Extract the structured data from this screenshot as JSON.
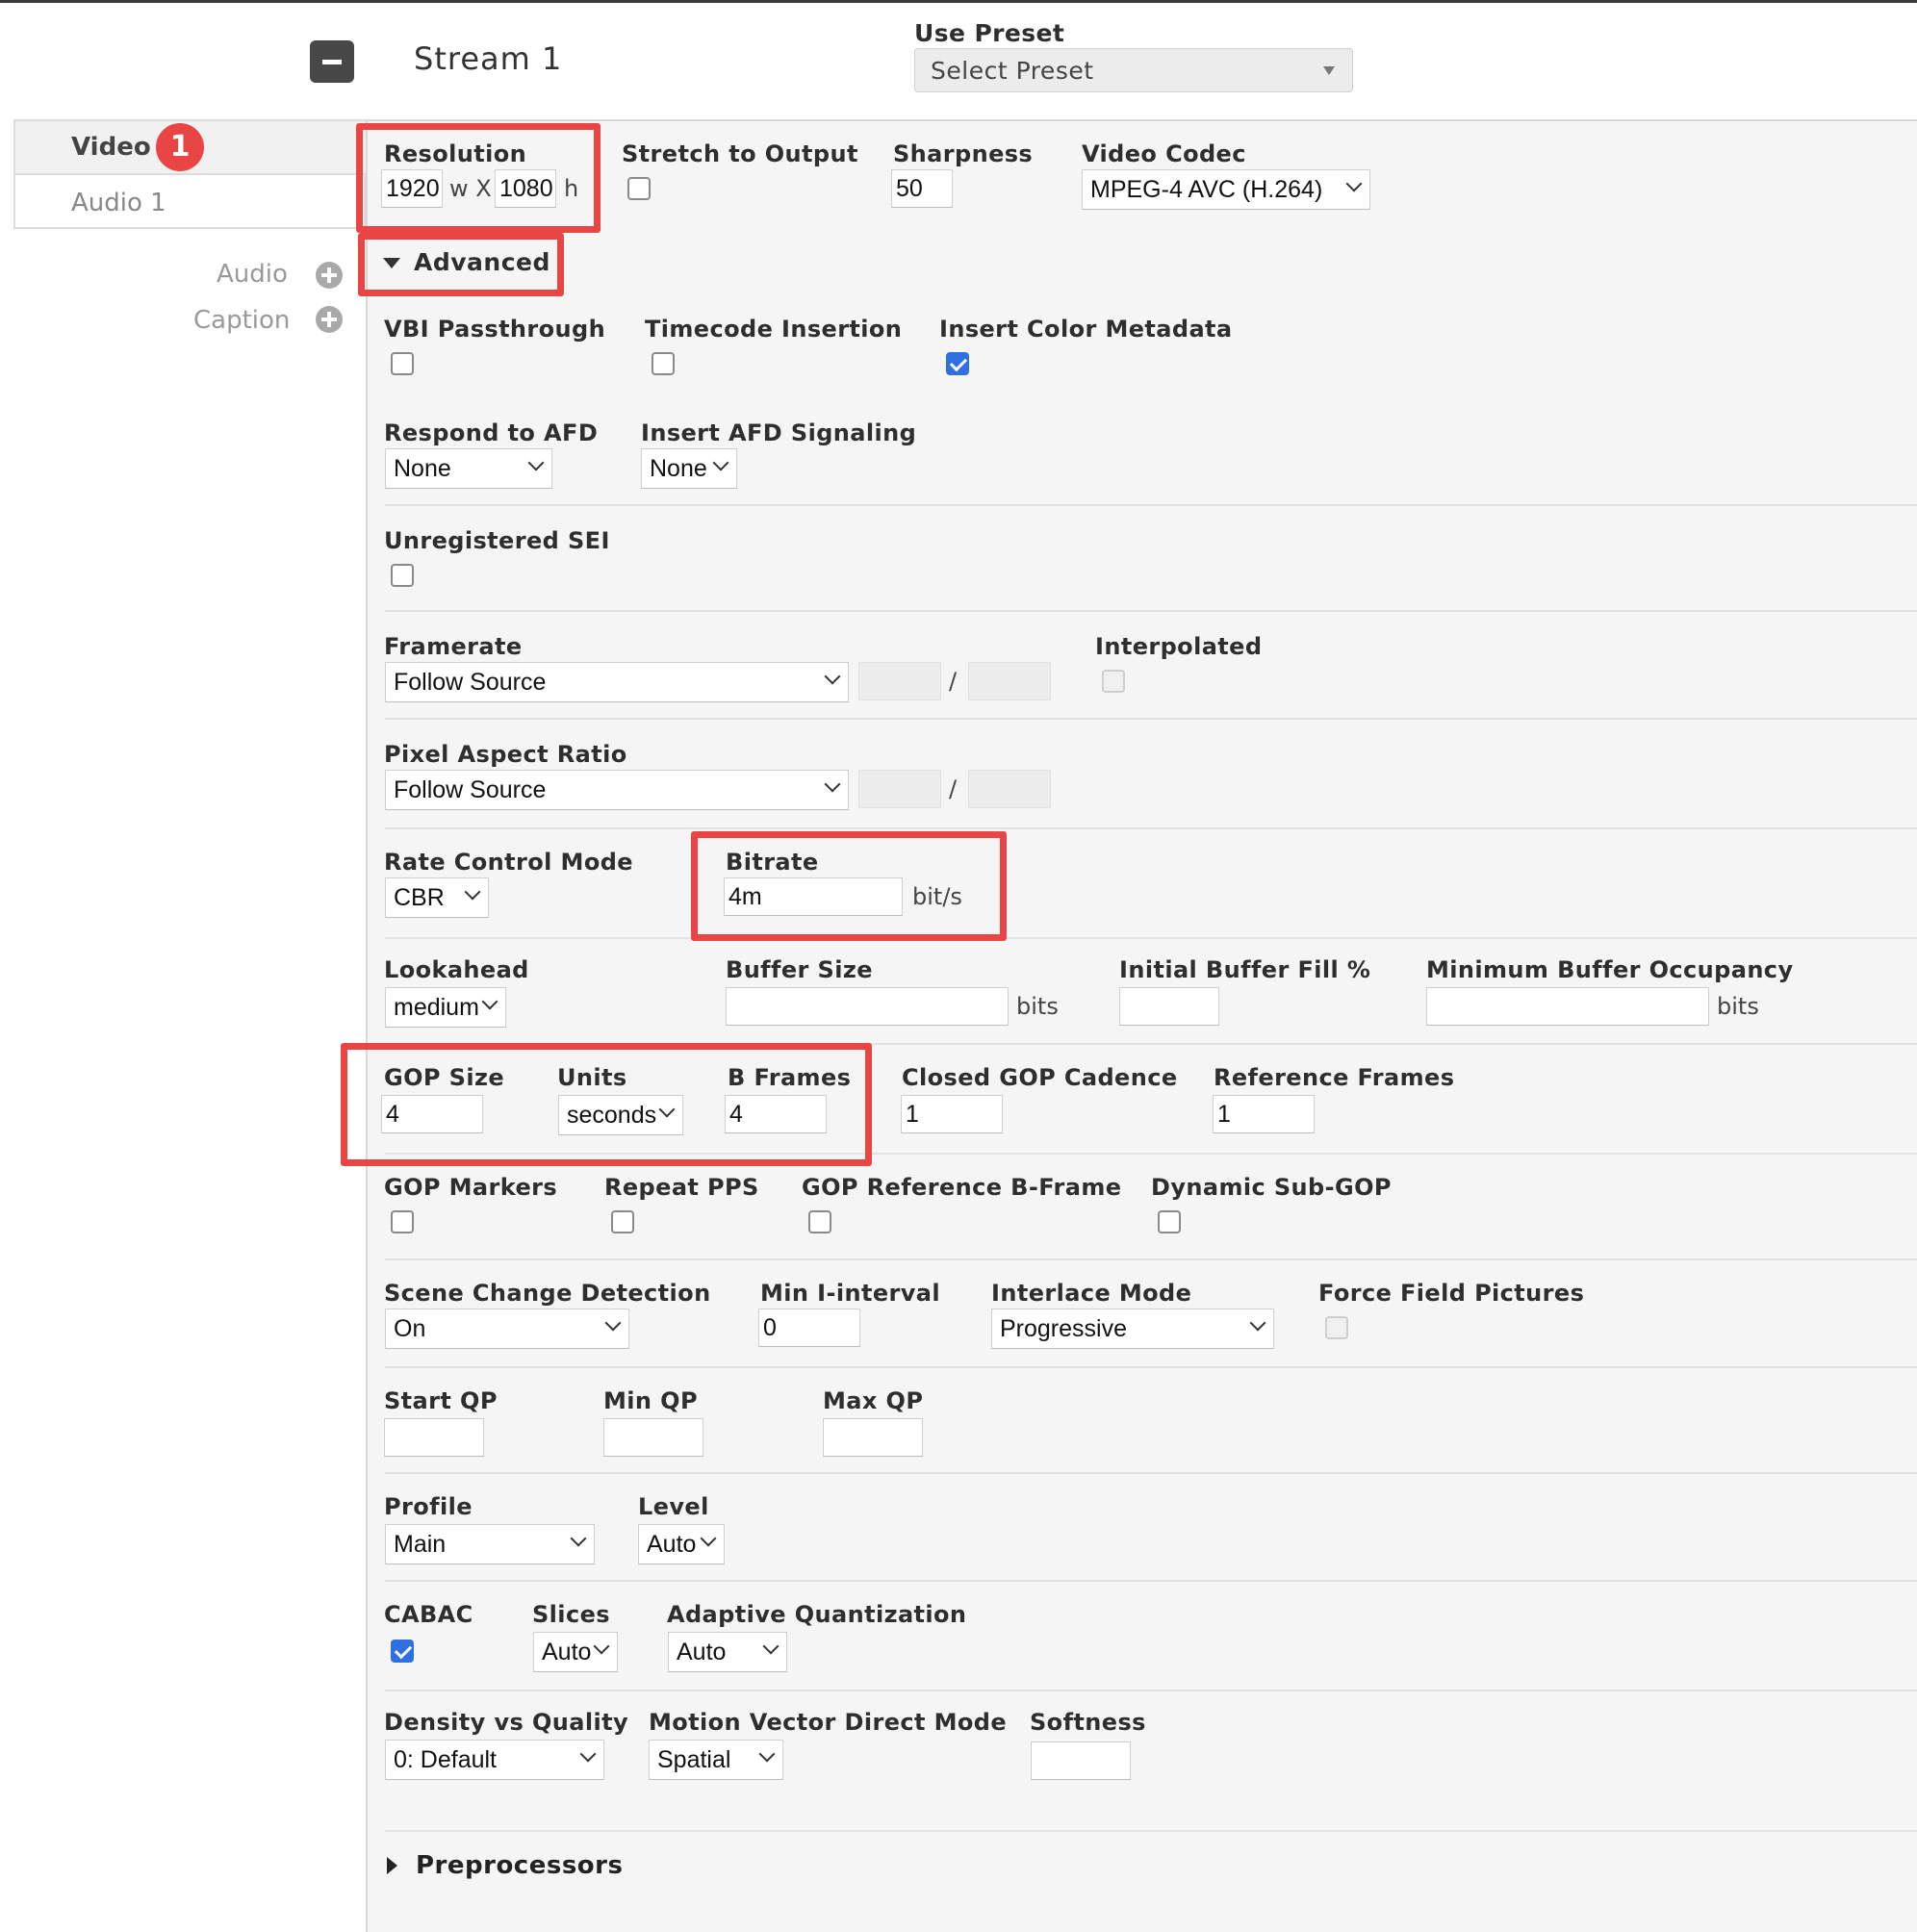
{
  "stream": {
    "collapse_icon": "minus-icon",
    "title": "Stream 1"
  },
  "preset": {
    "label": "Use Preset",
    "value": "Select Preset"
  },
  "tabs": {
    "video": "Video",
    "video_badge": "1",
    "audio": "Audio 1"
  },
  "add": {
    "audio": "Audio",
    "caption": "Caption",
    "icon": "plus-circle-icon"
  },
  "resolution": {
    "label": "Resolution",
    "width": "1920",
    "w_sep": "w X",
    "height": "1080",
    "h_unit": "h"
  },
  "stretch": {
    "label": "Stretch to Output"
  },
  "sharpness": {
    "label": "Sharpness",
    "value": "50"
  },
  "codec": {
    "label": "Video Codec",
    "value": "MPEG-4 AVC (H.264)"
  },
  "advanced": {
    "label": "Advanced"
  },
  "vbi": {
    "label": "VBI Passthrough"
  },
  "timecode": {
    "label": "Timecode Insertion"
  },
  "colormeta": {
    "label": "Insert Color Metadata"
  },
  "afd": {
    "label": "Respond to AFD",
    "value": "None"
  },
  "afd_signal": {
    "label": "Insert AFD Signaling",
    "value": "None"
  },
  "sei": {
    "label": "Unregistered SEI"
  },
  "framerate": {
    "label": "Framerate",
    "value": "Follow Source",
    "slash": "/"
  },
  "interpolated": {
    "label": "Interpolated"
  },
  "par": {
    "label": "Pixel Aspect Ratio",
    "value": "Follow Source",
    "slash": "/"
  },
  "rcm": {
    "label": "Rate Control Mode",
    "value": "CBR"
  },
  "bitrate": {
    "label": "Bitrate",
    "value": "4m",
    "unit": "bit/s"
  },
  "lookahead": {
    "label": "Lookahead",
    "value": "medium"
  },
  "buffer": {
    "label": "Buffer Size",
    "unit": "bits"
  },
  "initfill": {
    "label": "Initial Buffer Fill %"
  },
  "minbuf": {
    "label": "Minimum Buffer Occupancy",
    "unit": "bits"
  },
  "gop": {
    "label": "GOP Size",
    "value": "4"
  },
  "units": {
    "label": "Units",
    "value": "seconds"
  },
  "bframes": {
    "label": "B Frames",
    "value": "4"
  },
  "closedgop": {
    "label": "Closed GOP Cadence",
    "value": "1"
  },
  "refframes": {
    "label": "Reference Frames",
    "value": "1"
  },
  "gopmarkers": {
    "label": "GOP Markers"
  },
  "repeatpps": {
    "label": "Repeat PPS"
  },
  "gopref": {
    "label": "GOP Reference B-Frame"
  },
  "dynsub": {
    "label": "Dynamic Sub-GOP"
  },
  "scd": {
    "label": "Scene Change Detection",
    "value": "On"
  },
  "miniint": {
    "label": "Min I-interval",
    "value": "0"
  },
  "interlace": {
    "label": "Interlace Mode",
    "value": "Progressive"
  },
  "forcefield": {
    "label": "Force Field Pictures"
  },
  "startqp": {
    "label": "Start QP"
  },
  "minqp": {
    "label": "Min QP"
  },
  "maxqp": {
    "label": "Max QP"
  },
  "profile": {
    "label": "Profile",
    "value": "Main"
  },
  "level": {
    "label": "Level",
    "value": "Auto"
  },
  "cabac": {
    "label": "CABAC"
  },
  "slices": {
    "label": "Slices",
    "value": "Auto"
  },
  "aq": {
    "label": "Adaptive Quantization",
    "value": "Auto"
  },
  "dvq": {
    "label": "Density vs Quality",
    "value": "0: Default"
  },
  "mvdm": {
    "label": "Motion Vector Direct Mode",
    "value": "Spatial"
  },
  "softness": {
    "label": "Softness"
  },
  "preprocessors": {
    "label": "Preprocessors"
  },
  "colors": {
    "highlight": "#e94545",
    "checkbox": "#2f6fe0",
    "badge": "#e94545"
  }
}
